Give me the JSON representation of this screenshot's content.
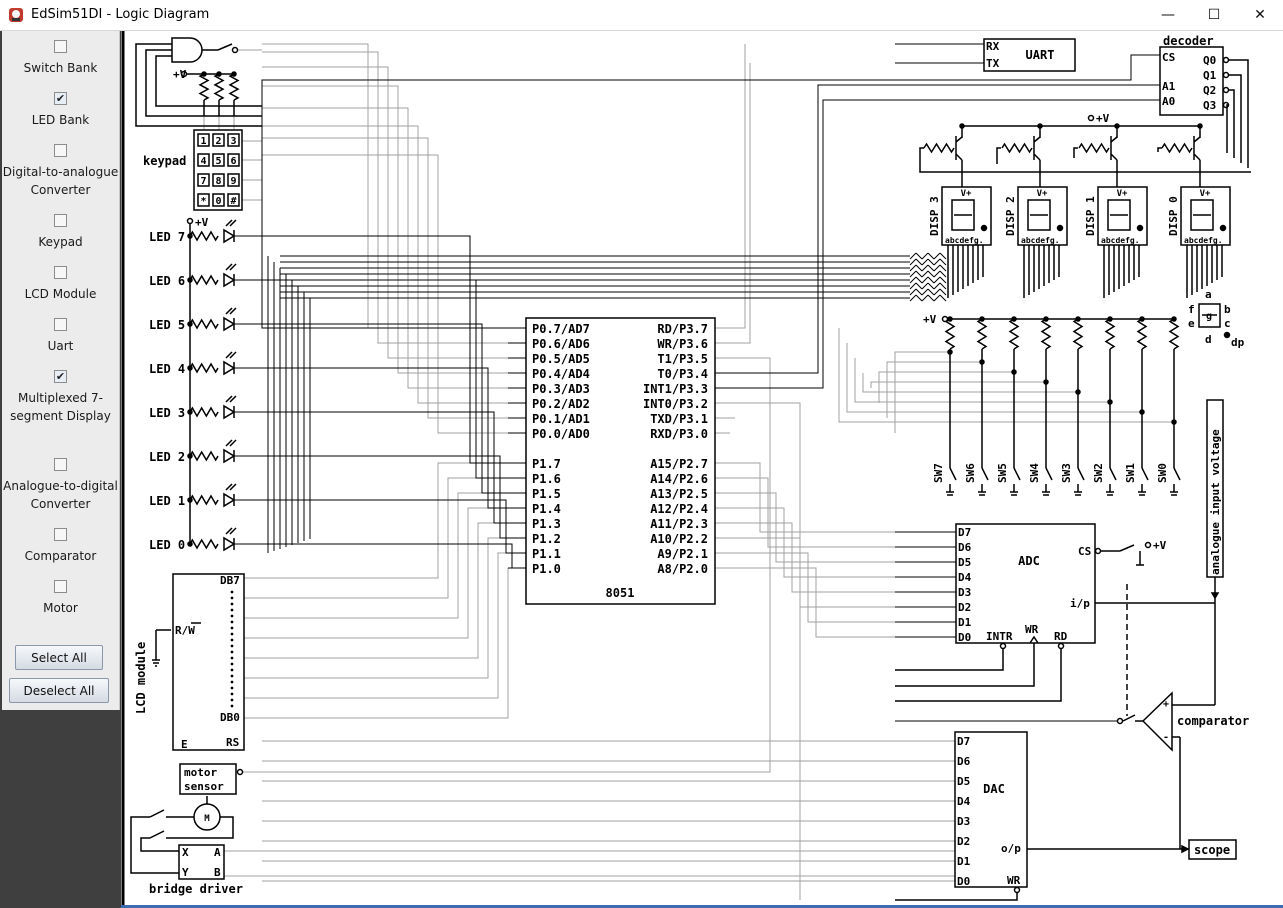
{
  "window": {
    "title": "EdSim51DI - Logic Diagram",
    "minimize_icon": "minimize-icon",
    "maximize_icon": "maximize-icon",
    "close_icon": "close-icon",
    "minimize": "—",
    "maximize": "☐",
    "close": "✕"
  },
  "sidebar": {
    "items": [
      {
        "label": "Switch Bank",
        "checked": false,
        "mark": ""
      },
      {
        "label": "LED Bank",
        "checked": true,
        "mark": "✔"
      },
      {
        "label": "Digital-to-analogue Converter",
        "checked": false,
        "mark": ""
      },
      {
        "label": "Keypad",
        "checked": false,
        "mark": ""
      },
      {
        "label": "LCD Module",
        "checked": false,
        "mark": ""
      },
      {
        "label": "Uart",
        "checked": false,
        "mark": ""
      },
      {
        "label": "Multiplexed 7-segment Display",
        "checked": true,
        "mark": "✔"
      },
      {
        "label": "Analogue-to-digital Converter",
        "checked": false,
        "mark": ""
      },
      {
        "label": "Comparator",
        "checked": false,
        "mark": ""
      },
      {
        "label": "Motor",
        "checked": false,
        "mark": ""
      }
    ],
    "select_all": "Select All",
    "deselect_all": "Deselect All"
  },
  "diagram": {
    "mcu": {
      "name": "8051",
      "left_pins": [
        "P0.7/AD7",
        "P0.6/AD6",
        "P0.5/AD5",
        "P0.4/AD4",
        "P0.3/AD3",
        "P0.2/AD2",
        "P0.1/AD1",
        "P0.0/AD0",
        "P1.7",
        "P1.6",
        "P1.5",
        "P1.4",
        "P1.3",
        "P1.2",
        "P1.1",
        "P1.0"
      ],
      "right_pins": [
        "RD/P3.7",
        "WR/P3.6",
        "T1/P3.5",
        "T0/P3.4",
        "INT1/P3.3",
        "INT0/P3.2",
        "TXD/P3.1",
        "RXD/P3.0",
        "A15/P2.7",
        "A14/P2.6",
        "A13/P2.5",
        "A12/P2.4",
        "A11/P2.3",
        "A10/P2.2",
        "A9/P2.1",
        "A8/P2.0"
      ]
    },
    "leds": [
      "LED 7",
      "LED 6",
      "LED 5",
      "LED 4",
      "LED 3",
      "LED 2",
      "LED 1",
      "LED 0"
    ],
    "keypad": {
      "label": "keypad",
      "keys": [
        "1",
        "2",
        "3",
        "4",
        "5",
        "6",
        "7",
        "8",
        "9",
        "*",
        "0",
        "#"
      ]
    },
    "vplus": "+V",
    "uart": {
      "label": "UART",
      "rx": "RX",
      "tx": "TX"
    },
    "decoder": {
      "label": "decoder",
      "cs": "CS",
      "a1": "A1",
      "a0": "A0",
      "outputs": [
        "Q0",
        "Q1",
        "Q2",
        "Q3"
      ]
    },
    "displays": [
      {
        "label": "DISP 3"
      },
      {
        "label": "DISP 2"
      },
      {
        "label": "DISP 1"
      },
      {
        "label": "DISP 0"
      }
    ],
    "seg_pins": "abcdefg.",
    "vplus_small": "V+",
    "segment_key": {
      "a": "a",
      "b": "b",
      "c": "c",
      "d": "d",
      "e": "e",
      "f": "f",
      "g": "g",
      "dp": "dp"
    },
    "switches": [
      "SW7",
      "SW6",
      "SW5",
      "SW4",
      "SW3",
      "SW2",
      "SW1",
      "SW0"
    ],
    "adc": {
      "label": "ADC",
      "pins": [
        "D7",
        "D6",
        "D5",
        "D4",
        "D3",
        "D2",
        "D1",
        "D0"
      ],
      "cs": "CS",
      "ip": "i/p",
      "intr": "INTR",
      "wr": "WR",
      "rd": "RD"
    },
    "analogue_input": "analogue input voltage",
    "comparator": "comparator",
    "dac": {
      "label": "DAC",
      "pins": [
        "D7",
        "D6",
        "D5",
        "D4",
        "D3",
        "D2",
        "D1",
        "D0"
      ],
      "op": "o/p",
      "wr": "WR"
    },
    "scope": "scope",
    "lcd": {
      "label": "LCD module",
      "db7": "DB7",
      "db0": "DB0",
      "rw": "R/W",
      "rs": "RS",
      "e": "E"
    },
    "motor_sensor": "motor sensor",
    "bridge": {
      "label": "bridge driver",
      "x": "X",
      "y": "Y",
      "a": "A",
      "b": "B"
    }
  }
}
